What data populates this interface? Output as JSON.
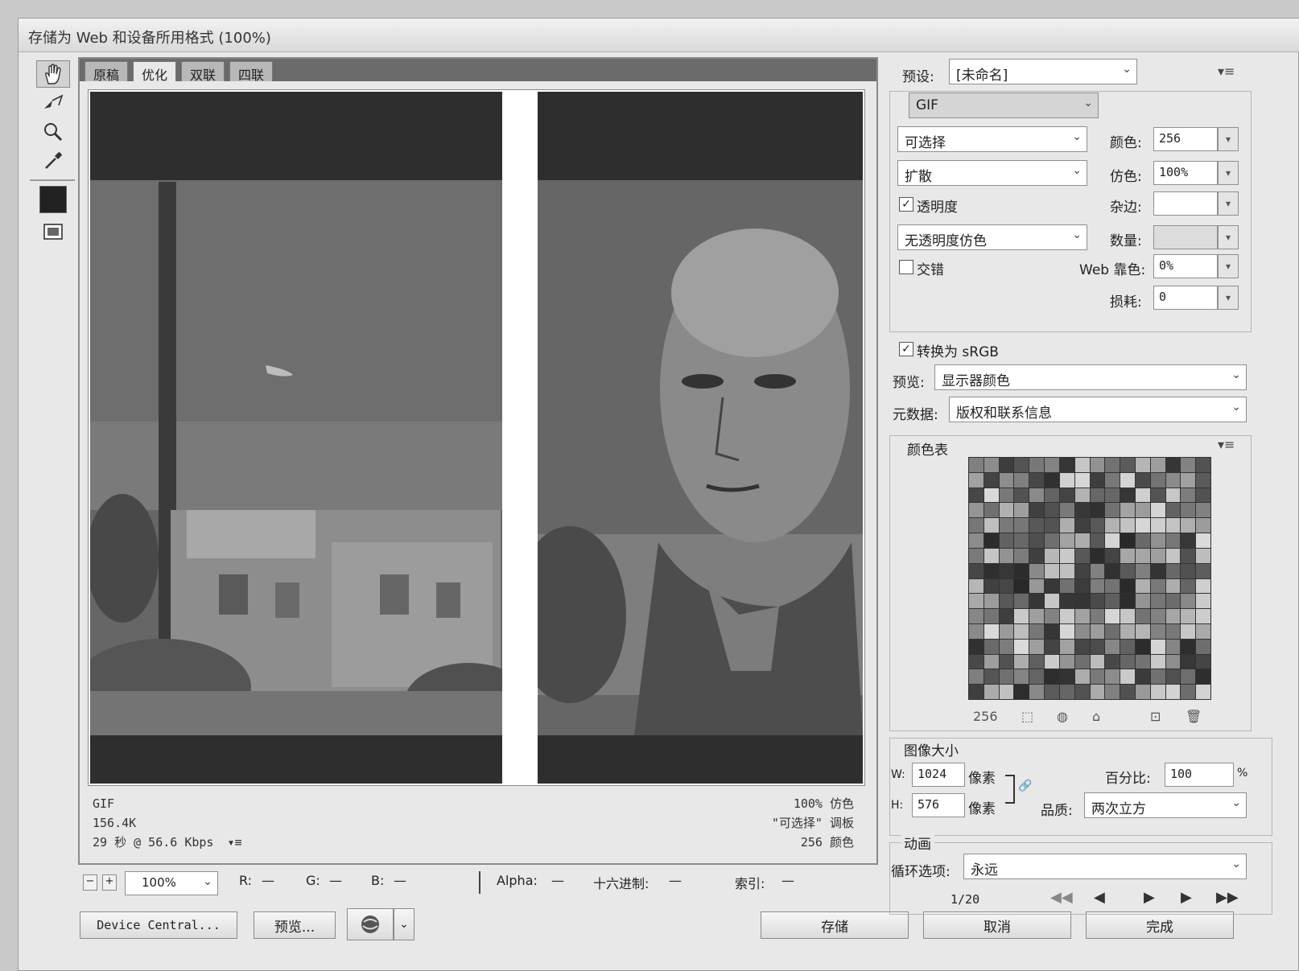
{
  "window": {
    "title": "存储为 Web 和设备所用格式 (100%)"
  },
  "tabs": [
    "原稿",
    "优化",
    "双联",
    "四联"
  ],
  "active_tab": 1,
  "info_left": [
    "GIF",
    "156.4K",
    "29 秒 @ 56.6 Kbps"
  ],
  "info_left_menu": "▾≡",
  "info_right": [
    "100% 仿色",
    "\"可选择\" 调板",
    "256 颜色"
  ],
  "status": {
    "zoom": "100%",
    "r_label": "R:",
    "r_val": "—",
    "g_label": "G:",
    "g_val": "—",
    "b_label": "B:",
    "b_val": "—",
    "alpha_label": "Alpha:",
    "alpha_val": "—",
    "hex_label": "十六进制:",
    "hex_val": "—",
    "index_label": "索引:",
    "index_val": "—"
  },
  "buttons": {
    "device_central": "Device Central...",
    "preview": "预览...",
    "save": "存储",
    "cancel": "取消",
    "done": "完成"
  },
  "settings": {
    "preset_label": "预设:",
    "preset_value": "[未命名]",
    "format": "GIF",
    "reduction": "可选择",
    "dither_algo": "扩散",
    "transparency_label": "透明度",
    "transparency_checked": true,
    "transparency_dither": "无透明度仿色",
    "interlaced_label": "交错",
    "interlaced_checked": false,
    "colors_label": "颜色:",
    "colors_value": "256",
    "dither_label": "仿色:",
    "dither_value": "100%",
    "matte_label": "杂边:",
    "matte_value": "",
    "amount_label": "数量:",
    "amount_value": "",
    "websnap_label": "Web 靠色:",
    "websnap_value": "0%",
    "lossy_label": "损耗:",
    "lossy_value": "0",
    "convert_srgb_label": "转换为 sRGB",
    "convert_srgb_checked": true,
    "preview_label": "预览:",
    "preview_value": "显示器颜色",
    "metadata_label": "元数据:",
    "metadata_value": "版权和联系信息"
  },
  "color_table": {
    "title": "颜色表",
    "count": "256"
  },
  "image_size": {
    "title": "图像大小",
    "w_label": "W:",
    "w_value": "1024",
    "w_unit": "像素",
    "h_label": "H:",
    "h_value": "576",
    "h_unit": "像素",
    "percent_label": "百分比:",
    "percent_value": "100",
    "percent_unit": "%",
    "quality_label": "品质:",
    "quality_value": "两次立方"
  },
  "animation": {
    "title": "动画",
    "loop_label": "循环选项:",
    "loop_value": "永远",
    "frame": "1/20"
  },
  "icons": {
    "menu": "▾≡",
    "check": "✓",
    "dropdown": "⌄"
  }
}
